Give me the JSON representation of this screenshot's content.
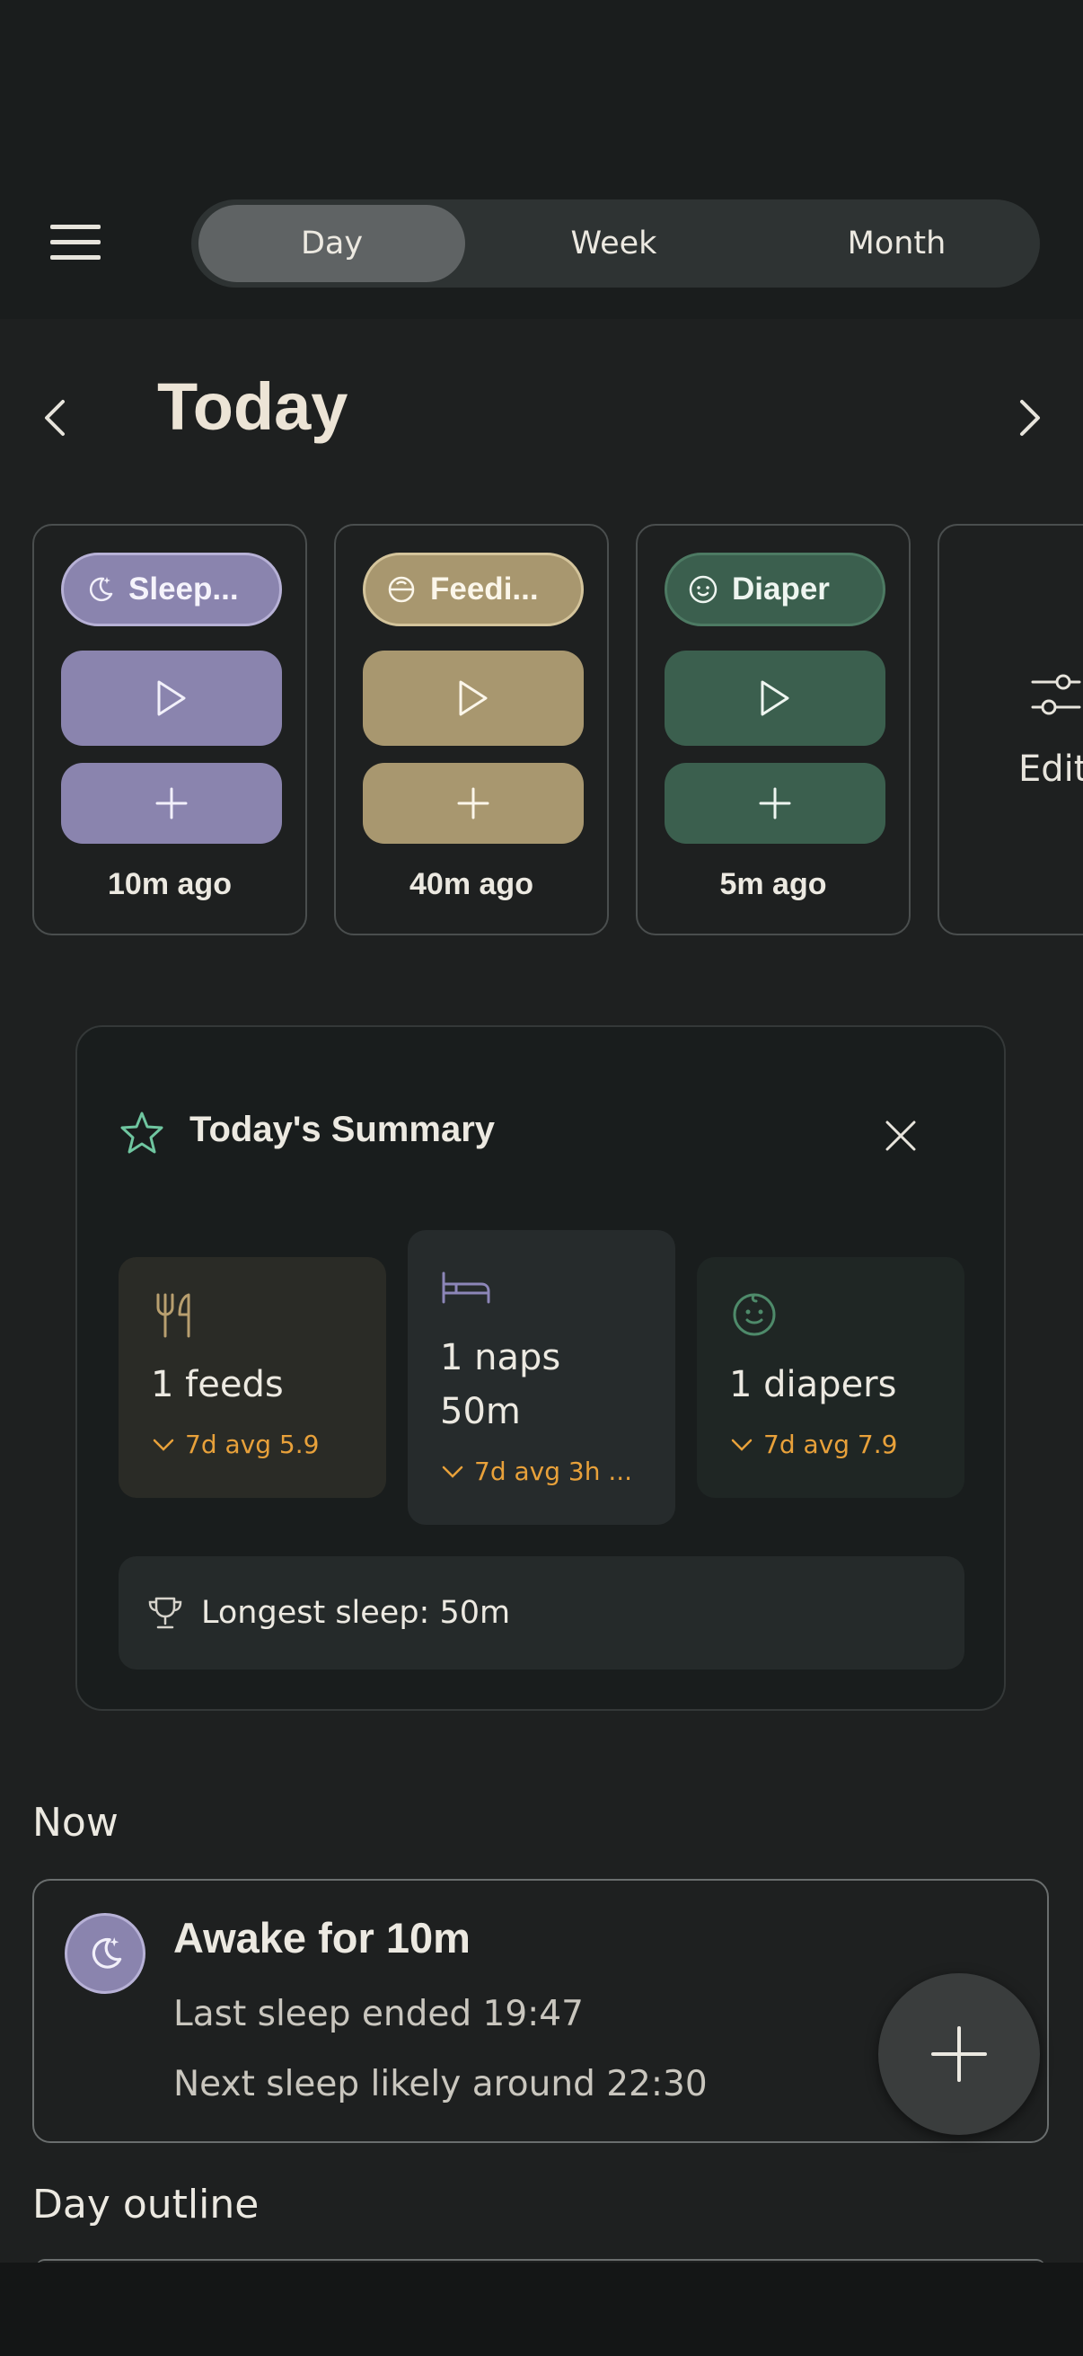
{
  "header": {
    "segments": [
      "Day",
      "Week",
      "Month"
    ],
    "active_segment": "Day"
  },
  "date": {
    "title": "Today"
  },
  "quick_actions": [
    {
      "label": "Sleep...",
      "icon": "moon-stars-icon",
      "color": "#8a84ae",
      "ago": "10m ago"
    },
    {
      "label": "Feedi...",
      "icon": "bowl-icon",
      "color": "#a8976f",
      "ago": "40m ago"
    },
    {
      "label": "Diaper",
      "icon": "baby-face-icon",
      "color": "#3b5f4e",
      "ago": "5m ago"
    }
  ],
  "edit_card": {
    "label": "Edit"
  },
  "summary": {
    "title": "Today's Summary",
    "stats": [
      {
        "value": "1 feeds",
        "avg": "7d avg 5.9",
        "icon": "fork-knife-icon"
      },
      {
        "value": "1 naps 50m",
        "avg": "7d avg 3h ...",
        "icon": "bed-icon"
      },
      {
        "value": "1 diapers",
        "avg": "7d avg 7.9",
        "icon": "baby-face-icon"
      }
    ],
    "longest": "Longest sleep: 50m"
  },
  "now": {
    "section_title": "Now",
    "headline": "Awake for 10m",
    "line1": "Last sleep ended 19:47",
    "line2": "Next sleep likely around 22:30"
  },
  "outline": {
    "section_title": "Day outline"
  },
  "colors": {
    "sleep": "#8a84ae",
    "feeding": "#a8976f",
    "diaper": "#3b5f4e",
    "accent_avg": "#e8a13a",
    "star": "#6fc6a0"
  }
}
